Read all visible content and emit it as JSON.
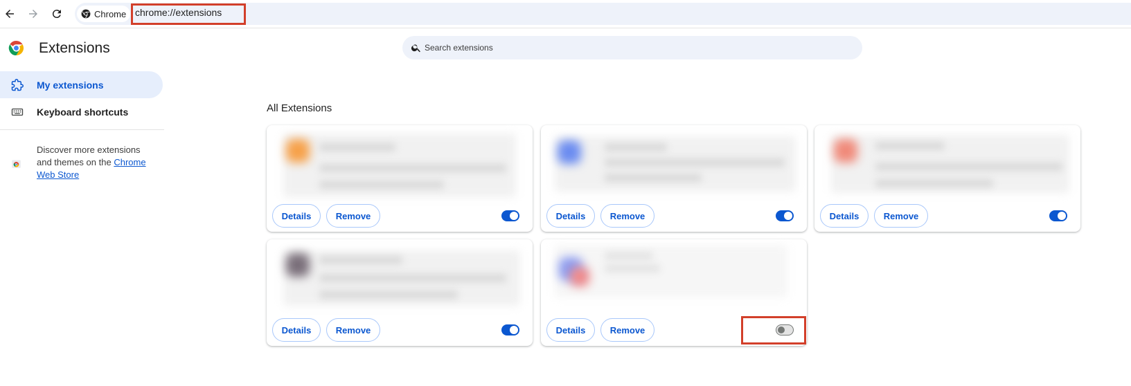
{
  "browser": {
    "chip_label": "Chrome",
    "url": "chrome://extensions"
  },
  "header": {
    "title": "Extensions",
    "search_placeholder": "Search extensions"
  },
  "sidebar": {
    "items": [
      {
        "label": "My extensions",
        "active": true
      },
      {
        "label": "Keyboard shortcuts",
        "active": false
      }
    ],
    "discover_text": "Discover more extensions and themes on the",
    "store_link": "Chrome Web Store"
  },
  "section": {
    "title": "All Extensions"
  },
  "extensions": [
    {
      "details_label": "Details",
      "remove_label": "Remove",
      "enabled": true,
      "accent": "#f6a14a"
    },
    {
      "details_label": "Details",
      "remove_label": "Remove",
      "enabled": true,
      "accent": "#6b8cf0"
    },
    {
      "details_label": "Details",
      "remove_label": "Remove",
      "enabled": true,
      "accent": "#f08a7a"
    },
    {
      "details_label": "Details",
      "remove_label": "Remove",
      "enabled": true,
      "accent": "#7a6f7a"
    },
    {
      "details_label": "Details",
      "remove_label": "Remove",
      "enabled": false,
      "accent": "#8c9cf0"
    }
  ],
  "colors": {
    "accent": "#0b57d0",
    "highlight": "#d23f2a"
  }
}
